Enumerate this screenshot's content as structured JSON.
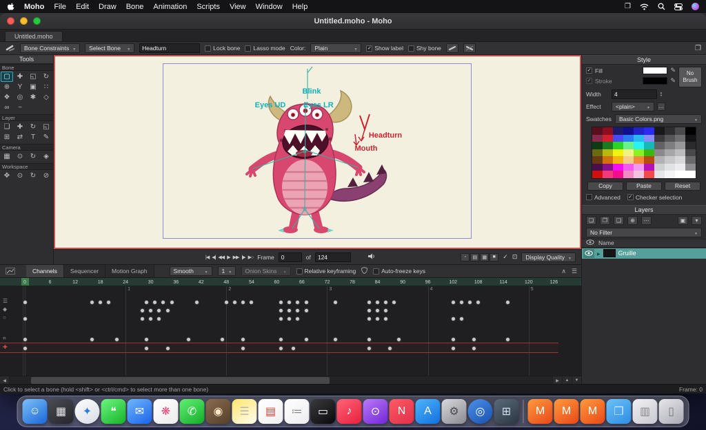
{
  "menubar": {
    "items": [
      "Moho",
      "File",
      "Edit",
      "Draw",
      "Bone",
      "Animation",
      "Scripts",
      "View",
      "Window",
      "Help"
    ]
  },
  "window": {
    "title": "Untitled.moho - Moho",
    "tab": "Untitled.moho"
  },
  "toolbar": {
    "bone_constraints": "Bone Constraints",
    "select_bone": "Select Bone",
    "bone_name_value": "Headturn",
    "lock_bone": "Lock bone",
    "lasso_mode": "Lasso mode",
    "color_label": "Color:",
    "color_value": "Plain",
    "show_label": "Show label",
    "shy_bone": "Shy bone"
  },
  "tools": {
    "title": "Tools",
    "sections": [
      {
        "label": "Bone",
        "tools": [
          {
            "name": "select-bone",
            "glyph": "▢",
            "selected": true
          },
          {
            "name": "translate-bone",
            "glyph": "✚"
          },
          {
            "name": "scale-bone",
            "glyph": "◱"
          },
          {
            "name": "rotate-bone",
            "glyph": "↻"
          },
          {
            "name": "add-bone",
            "glyph": "⊕"
          },
          {
            "name": "reparent-bone",
            "glyph": "Y"
          },
          {
            "name": "bind-layer",
            "glyph": "▣"
          },
          {
            "name": "bind-points",
            "glyph": "∷"
          },
          {
            "name": "flexi-bind",
            "glyph": "❖"
          },
          {
            "name": "bone-strength",
            "glyph": "◎"
          },
          {
            "name": "smart-bone-dial",
            "glyph": "✱"
          },
          {
            "name": "transform-bone",
            "glyph": "◇"
          },
          {
            "name": "bone-constraints",
            "glyph": "∞"
          },
          {
            "name": "bone-dynamics",
            "glyph": "~"
          }
        ]
      },
      {
        "label": "Layer",
        "tools": [
          {
            "name": "select-layer",
            "glyph": "❏"
          },
          {
            "name": "translate-layer",
            "glyph": "✚"
          },
          {
            "name": "rotate-layer",
            "glyph": "↻"
          },
          {
            "name": "scale-layer",
            "glyph": "◱"
          },
          {
            "name": "follow-path",
            "glyph": "⊞"
          },
          {
            "name": "flip-layer",
            "glyph": "⇄"
          },
          {
            "name": "text-tool",
            "glyph": "T"
          },
          {
            "name": "pencil-tool",
            "glyph": "✎"
          }
        ]
      },
      {
        "label": "Camera",
        "tools": [
          {
            "name": "track-camera",
            "glyph": "▦"
          },
          {
            "name": "zoom-camera",
            "glyph": "⊙"
          },
          {
            "name": "roll-camera",
            "glyph": "↻"
          },
          {
            "name": "pan-tilt-camera",
            "glyph": "◈"
          }
        ]
      },
      {
        "label": "Workspace",
        "tools": [
          {
            "name": "pan-workspace",
            "glyph": "✥"
          },
          {
            "name": "zoom-workspace",
            "glyph": "⊙"
          },
          {
            "name": "rotate-workspace",
            "glyph": "↻"
          },
          {
            "name": "orbit-workspace",
            "glyph": "⊘"
          }
        ]
      }
    ]
  },
  "canvas": {
    "labels": {
      "blink": "Blink",
      "eyes_ud": "Eyes UD",
      "eyes_lr": "Eyes LR",
      "headturn": "Headturn",
      "mouth": "Mouth"
    }
  },
  "playback": {
    "transport": [
      {
        "name": "jump-to-start",
        "glyph": "|◀"
      },
      {
        "name": "previous-keyframe",
        "glyph": "◀|"
      },
      {
        "name": "step-back",
        "glyph": "◀◀"
      },
      {
        "name": "play",
        "glyph": "▶"
      },
      {
        "name": "step-forward",
        "glyph": "▶▶"
      },
      {
        "name": "next-keyframe",
        "glyph": "|▶"
      },
      {
        "name": "loop",
        "glyph": "▶○"
      }
    ],
    "frame_label": "Frame",
    "frame_value": "0",
    "of_label": "of",
    "end_value": "124",
    "quality_icons": [
      {
        "name": "quality-outline",
        "glyph": "▫"
      },
      {
        "name": "quality-flat",
        "glyph": "▤"
      },
      {
        "name": "quality-shaded",
        "glyph": "▦"
      },
      {
        "name": "quality-full",
        "glyph": "■"
      }
    ],
    "check_glyph": "✓",
    "safe_area_glyph": "⊡",
    "display_quality": "Display Quality"
  },
  "timeline": {
    "tabs": [
      {
        "label": "Channels",
        "active": true
      },
      {
        "label": "Sequencer",
        "active": false
      },
      {
        "label": "Motion Graph",
        "active": false
      }
    ],
    "smooth": "Smooth",
    "step": "1",
    "onion": "Onion Skins",
    "relative": "Relative keyframing",
    "autofreeze": "Auto-freeze keys",
    "ticks": [
      0,
      6,
      12,
      18,
      24,
      30,
      36,
      42,
      48,
      54,
      60,
      66,
      72,
      78,
      84,
      90,
      96,
      102,
      108,
      114,
      120,
      126
    ],
    "seconds": [
      1,
      2,
      3,
      4,
      5
    ],
    "tracks": [
      {
        "name": "head-channel",
        "glyph": "☰",
        "row": 0,
        "red": false,
        "frames": [
          0,
          16,
          18,
          20,
          29,
          31,
          33,
          35,
          41,
          48,
          50,
          52,
          54,
          61,
          63,
          65,
          67,
          74,
          82,
          84,
          86,
          88,
          102,
          104,
          106,
          108,
          115
        ]
      },
      {
        "name": "rotation-channel",
        "glyph": "◆",
        "row": 1,
        "red": false,
        "frames": [
          28,
          30,
          32,
          34,
          61,
          63,
          65,
          67,
          82,
          84,
          86
        ]
      },
      {
        "name": "translation-channel",
        "glyph": "○",
        "row": 2,
        "red": false,
        "frames": [
          0,
          28,
          30,
          32,
          61,
          63,
          65,
          82,
          84,
          86,
          102,
          104
        ]
      },
      {
        "name": "switch-channel",
        "glyph": "⌗",
        "row": 3,
        "red": false,
        "frames": [
          0,
          16,
          22,
          29,
          39,
          47,
          52,
          61,
          67,
          74,
          82,
          89,
          102,
          107,
          115
        ]
      },
      {
        "name": "selected-bone-channel",
        "glyph": "✚",
        "row": 4,
        "red": true,
        "frames": [
          0,
          29,
          34,
          52,
          61,
          64,
          82,
          87,
          102,
          107
        ]
      }
    ]
  },
  "style_panel": {
    "title": "Style",
    "fill": "Fill",
    "stroke": "Stroke",
    "no_brush": "No Brush",
    "width_label": "Width",
    "width_value": "4",
    "effect_label": "Effect",
    "effect_value": "<plain>",
    "swatches_label": "Swatches",
    "swatches_value": "Basic Colors.png",
    "copy": "Copy",
    "paste": "Paste",
    "reset": "Reset",
    "advanced": "Advanced",
    "checker": "Checker selection",
    "palette": [
      [
        "#5a0f1e",
        "#8a1020",
        "#1a1a6e",
        "#10108e",
        "#2222c8",
        "#2a2af2",
        "#18181a",
        "#2e2e30",
        "#4a4a4c",
        "#000000"
      ],
      [
        "#8a2a4a",
        "#d22030",
        "#4a4af2",
        "#2a7af2",
        "#2ab8f2",
        "#8a8af8",
        "#3a3a3c",
        "#565658",
        "#6e6e70",
        "#141416"
      ],
      [
        "#0e3a14",
        "#1a7a20",
        "#2ad22a",
        "#6af28a",
        "#2af2f2",
        "#18b8b8",
        "#626264",
        "#7e7e80",
        "#98989a",
        "#2a2a2c"
      ],
      [
        "#6a6a10",
        "#b8b810",
        "#f2f210",
        "#f2f282",
        "#8af220",
        "#3ab810",
        "#8a8a8c",
        "#a6a6a8",
        "#bcbcbe",
        "#48484a"
      ],
      [
        "#6a3a10",
        "#d2720e",
        "#f2b810",
        "#f2ce8a",
        "#f28a3a",
        "#b84a0e",
        "#b2b2b4",
        "#c8c8ca",
        "#d8d8da",
        "#6a6a6c"
      ],
      [
        "#4a0e4a",
        "#8a108a",
        "#f210f2",
        "#f25af2",
        "#f29af2",
        "#b810b8",
        "#ced0d2",
        "#e0e2e4",
        "#ececee",
        "#8e8e90"
      ],
      [
        "#d20e0e",
        "#f23a7a",
        "#f20e8a",
        "#f28ac2",
        "#f2c2de",
        "#f24a4a",
        "#e6e6e8",
        "#f4f4f6",
        "#ffffff",
        "#ffffff"
      ]
    ]
  },
  "layers_panel": {
    "title": "Layers",
    "filter": "No Filter",
    "name_header": "Name",
    "layer_name": "Gruille",
    "toolbar_left": [
      {
        "name": "new-layer",
        "glyph": "❏"
      },
      {
        "name": "new-group",
        "glyph": "❐"
      },
      {
        "name": "duplicate-layer",
        "glyph": "❑"
      },
      {
        "name": "add-bone-layer",
        "glyph": "⊕"
      },
      {
        "name": "more-layer-options",
        "glyph": "⋯"
      }
    ],
    "toolbar_right": [
      {
        "name": "layer-settings",
        "glyph": "▣"
      },
      {
        "name": "layers-menu",
        "glyph": "▾"
      }
    ]
  },
  "status": {
    "message": "Click to select a bone (hold <shift> or <ctrl/cmd> to select more than one bone)",
    "frame": "Frame: 0"
  },
  "dock": {
    "items": [
      {
        "name": "finder",
        "c1": "#7cc0f8",
        "c2": "#1a66d8",
        "glyph": "☺",
        "fg": "#ffffff"
      },
      {
        "name": "launchpad",
        "c1": "#4a4a52",
        "c2": "#26262c",
        "glyph": "▦",
        "fg": "#e8e8e8"
      },
      {
        "name": "safari",
        "circle": true,
        "c1": "#fdfdfd",
        "c2": "#d8dde6",
        "glyph": "✦",
        "fg": "#2a7de1"
      },
      {
        "name": "messages",
        "c1": "#6df57f",
        "c2": "#16b329",
        "glyph": "❝",
        "fg": "#ffffff"
      },
      {
        "name": "mail",
        "c1": "#6fb6ff",
        "c2": "#1a63e8",
        "glyph": "✉",
        "fg": "#ffffff"
      },
      {
        "name": "photos",
        "c1": "#ffffff",
        "c2": "#ebebeb",
        "glyph": "❋",
        "fg": "#e8447a"
      },
      {
        "name": "facetime",
        "c1": "#63ef75",
        "c2": "#12ad28",
        "glyph": "✆",
        "fg": "#ffffff"
      },
      {
        "name": "photo-booth",
        "c1": "#8a6a4e",
        "c2": "#54402c",
        "glyph": "◉",
        "fg": "#ffe9c8"
      },
      {
        "name": "notes",
        "c1": "#ffe66a",
        "c2": "#fffdf4",
        "glyph": "☰",
        "fg": "#b8b8b8"
      },
      {
        "name": "calendar",
        "c1": "#ffffff",
        "c2": "#f0f0f0",
        "glyph": "▤",
        "fg": "#e03b30"
      },
      {
        "name": "reminders",
        "c1": "#ffffff",
        "c2": "#ededf0",
        "glyph": "≔",
        "fg": "#888888"
      },
      {
        "name": "tv",
        "c1": "#3a3a3e",
        "c2": "#0a0a0c",
        "glyph": "▭",
        "fg": "#ffffff"
      },
      {
        "name": "music",
        "c1": "#ff6378",
        "c2": "#e8203e",
        "glyph": "♪",
        "fg": "#ffffff"
      },
      {
        "name": "podcasts",
        "c1": "#b97af8",
        "c2": "#7226d8",
        "glyph": "⊙",
        "fg": "#ffffff"
      },
      {
        "name": "news",
        "c1": "#ff5a66",
        "c2": "#e03048",
        "glyph": "N",
        "fg": "#ffffff"
      },
      {
        "name": "app-store",
        "c1": "#4fb4f8",
        "c2": "#1070e0",
        "glyph": "A",
        "fg": "#ffffff"
      },
      {
        "name": "system-settings",
        "c1": "#d8d8dc",
        "c2": "#8a8a92",
        "glyph": "⚙",
        "fg": "#4a4a50"
      },
      {
        "name": "app-blue",
        "circle": true,
        "c1": "#4a90e8",
        "c2": "#1a50b0",
        "glyph": "◎",
        "fg": "#ffffff"
      },
      {
        "name": "app-utility",
        "c1": "#5a6a7a",
        "c2": "#2c3642",
        "glyph": "⊞",
        "fg": "#d0e0f0"
      },
      {
        "separator": true
      },
      {
        "name": "moho-1",
        "c1": "#ff9a3c",
        "c2": "#e8481a",
        "glyph": "M",
        "fg": "#ffffff"
      },
      {
        "name": "moho-2",
        "c1": "#ff9a3c",
        "c2": "#e8481a",
        "glyph": "M",
        "fg": "#ffffff"
      },
      {
        "name": "moho-3",
        "c1": "#ff9a3c",
        "c2": "#e8481a",
        "glyph": "M",
        "fg": "#ffffff"
      },
      {
        "name": "folder",
        "c1": "#6cc1f7",
        "c2": "#2f8de4",
        "glyph": "❐",
        "fg": "#cfe9ff"
      },
      {
        "name": "files",
        "c1": "#f0f0f4",
        "c2": "#c8c8d0",
        "glyph": "▥",
        "fg": "#888888"
      },
      {
        "name": "trash",
        "c1": "#e6e6ea",
        "c2": "#aaaab4",
        "glyph": "▯",
        "fg": "#777777"
      }
    ]
  }
}
